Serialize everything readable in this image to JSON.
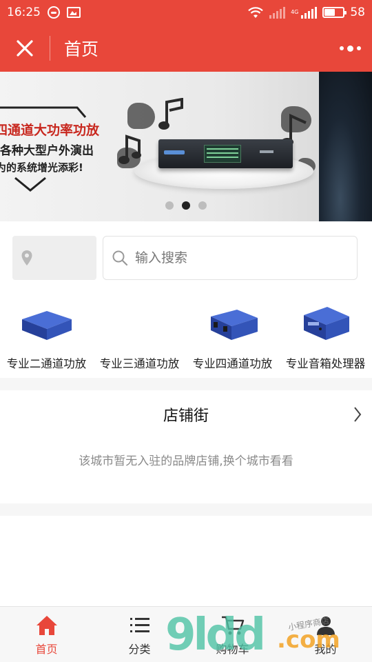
{
  "status_bar": {
    "time": "16:25",
    "network_type": "4G",
    "battery_level": "58"
  },
  "nav": {
    "title": "首页"
  },
  "banner": {
    "headline": "四通道大功率功放",
    "line2": "各种大型户外演出",
    "line3": "为的系统增光添彩!",
    "slide_count": 3,
    "active_slide": 2
  },
  "search": {
    "location_value": "",
    "placeholder": "输入搜索"
  },
  "categories": [
    {
      "label": "专业二通道功放",
      "icon": "amplifier-icon"
    },
    {
      "label": "专业三通道功放",
      "icon": "amplifier-icon"
    },
    {
      "label": "专业四通道功放",
      "icon": "amplifier-icon"
    },
    {
      "label": "专业音箱处理器",
      "icon": "speaker-processor-icon"
    }
  ],
  "shop_street": {
    "title": "店铺街",
    "empty_text": "该城市暂无入驻的品牌店铺,换个城市看看"
  },
  "tab_bar": [
    {
      "label": "首页",
      "icon": "home-icon",
      "active": true
    },
    {
      "label": "分类",
      "icon": "list-icon",
      "active": false
    },
    {
      "label": "购物车",
      "icon": "cart-icon",
      "active": false
    },
    {
      "label": "我的",
      "icon": "user-icon",
      "active": false
    }
  ],
  "watermark": {
    "main": "9ldd",
    "suffix": ".com",
    "tagline": "小程序商店"
  },
  "colors": {
    "brand_red": "#e8473a",
    "category_blue": "#2f4fb3",
    "empty_text_gray": "#8a8a8a"
  }
}
